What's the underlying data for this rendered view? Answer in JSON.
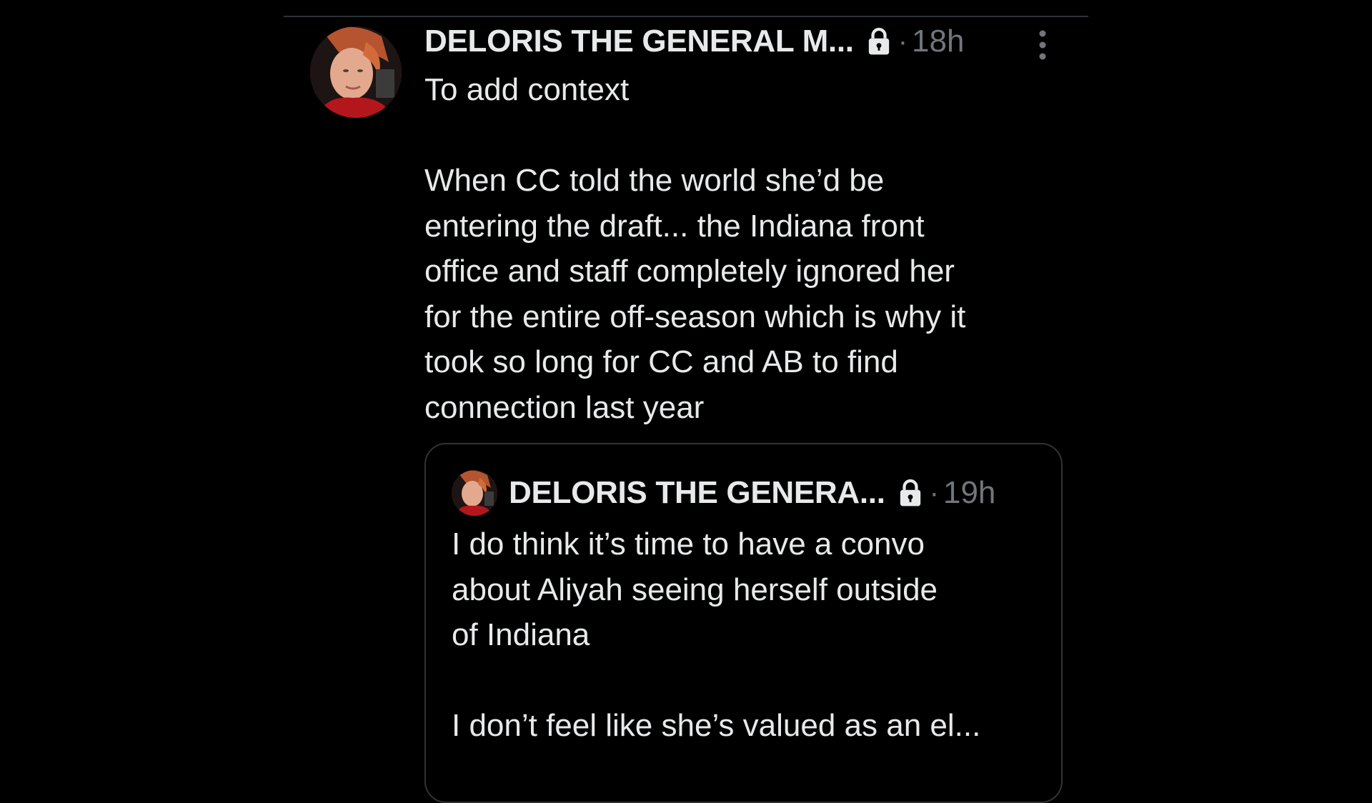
{
  "tweet": {
    "display_name": "DELORIS THE GENERAL M...",
    "separator": "·",
    "timestamp": "18h",
    "lines_intro": [
      "To add context"
    ],
    "lines_body": [
      "When CC told the world she’d be",
      "entering the draft... the Indiana front",
      "office and staff completely ignored her",
      "for the entire off-season which is why it",
      "took so long for CC and AB to find",
      "connection last year"
    ],
    "icons": {
      "protected": "lock-icon",
      "more": "more-vertical-icon"
    }
  },
  "quoted_tweet": {
    "display_name": "DELORIS THE GENERA...",
    "separator": "·",
    "timestamp": "19h",
    "lines_para1": [
      "I do think it’s time to have a convo",
      "about Aliyah seeing herself outside",
      "of Indiana"
    ],
    "lines_para2": [
      "I don’t feel like she’s valued as an el..."
    ]
  },
  "colors": {
    "background": "#000000",
    "text_primary": "#e7e9ea",
    "text_secondary": "#71767b",
    "border": "#2f3336"
  }
}
